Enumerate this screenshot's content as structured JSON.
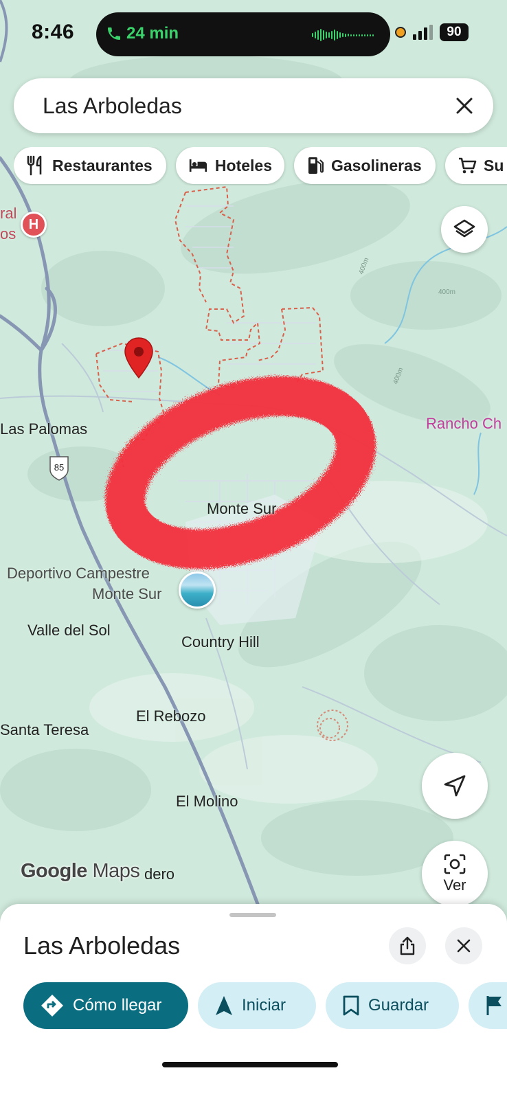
{
  "status_bar": {
    "time": "8:46",
    "call_duration": "24 min",
    "battery": "90"
  },
  "search": {
    "query": "Las Arboledas"
  },
  "chips": [
    {
      "label": "Restaurantes",
      "icon": "restaurant-icon"
    },
    {
      "label": "Hoteles",
      "icon": "hotel-icon"
    },
    {
      "label": "Gasolineras",
      "icon": "gas-station-icon"
    },
    {
      "label": "Su",
      "icon": "cart-icon"
    }
  ],
  "map": {
    "labels": {
      "las_palomas": "Las Palomas",
      "monte_sur": "Monte Sur",
      "deportivo_line1": "Deportivo Campestre",
      "deportivo_line2": "Monte Sur",
      "valle_del_sol": "Valle del Sol",
      "country_hill": "Country Hill",
      "santa_teresa": "Santa Teresa",
      "el_rebozo": "El Rebozo",
      "el_molino": "El Molino",
      "rancho": "Rancho Ch",
      "dero": "dero",
      "hospital_partial_1": "ral",
      "hospital_partial_2": "os",
      "route_shield": "85",
      "contour_400_a": "400m",
      "contour_400_b": "400m",
      "contour_400_c": "400m"
    },
    "google_logo": "Google",
    "maps_word": "Maps",
    "colors": {
      "map_background": "#cfe9dc",
      "highway": "#8797b3",
      "annotation": "#f2303c",
      "pin": "#e02424",
      "boundary": "#d9604a"
    }
  },
  "buttons": {
    "layers_icon": "layers-icon",
    "location_icon": "navigation-arrow-icon",
    "ver_label": "Ver"
  },
  "sheet": {
    "title": "Las Arboledas",
    "actions": {
      "directions": "Cómo llegar",
      "start": "Iniciar",
      "save": "Guardar"
    }
  }
}
